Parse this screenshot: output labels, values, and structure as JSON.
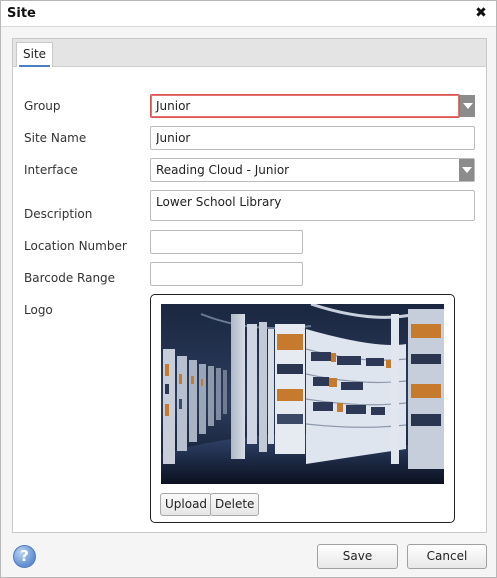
{
  "window": {
    "title": "Site",
    "close_glyph": "✖"
  },
  "tabs": [
    {
      "label": "Site",
      "active": true
    }
  ],
  "form": {
    "group": {
      "label": "Group",
      "value": "Junior",
      "error": true
    },
    "site_name": {
      "label": "Site Name",
      "value": "Junior"
    },
    "interface": {
      "label": "Interface",
      "value": "Reading Cloud - Junior"
    },
    "description": {
      "label": "Description",
      "value": "Lower School Library"
    },
    "location_number": {
      "label": "Location Number",
      "value": ""
    },
    "barcode_range": {
      "label": "Barcode Range",
      "value": ""
    },
    "logo": {
      "label": "Logo",
      "upload_label": "Upload",
      "delete_label": "Delete"
    }
  },
  "footer": {
    "help_glyph": "?",
    "save_label": "Save",
    "cancel_label": "Cancel"
  },
  "colors": {
    "error_border": "#d9534f",
    "tab_accent": "#4a7fc1",
    "dropdown_arrow": "#8c8c8c"
  },
  "icons": [
    "close-icon",
    "chevron-down-icon",
    "help-icon"
  ]
}
